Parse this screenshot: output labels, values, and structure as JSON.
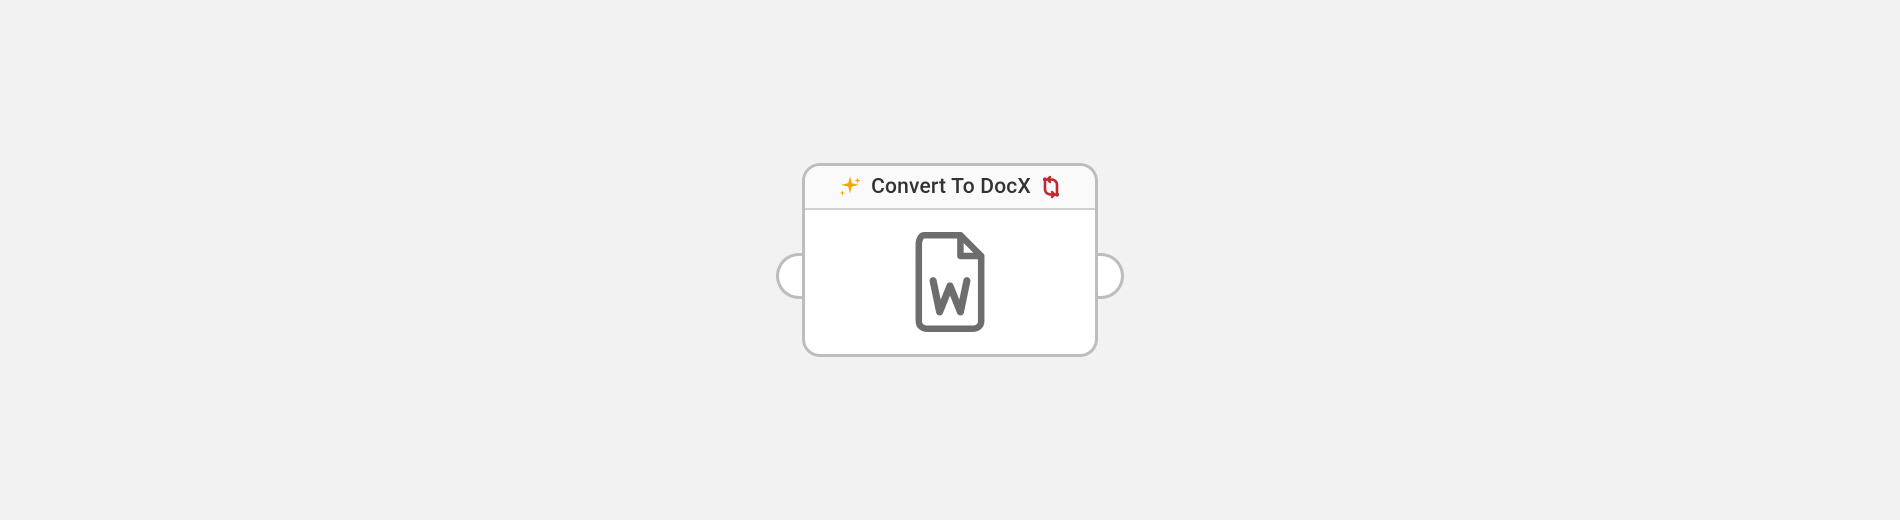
{
  "node": {
    "title": "Convert To DocX",
    "icons": {
      "left": "sparkle-icon",
      "right": "swap-icon",
      "body": "docx-file-icon"
    },
    "colors": {
      "sparkle": "#f4a500",
      "swap": "#c1272d",
      "file": "#6d6d6d",
      "border": "#bdbdbd"
    }
  }
}
